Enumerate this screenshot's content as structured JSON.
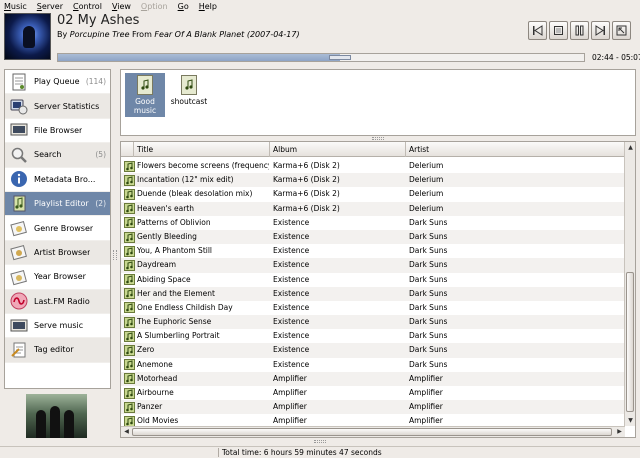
{
  "menu": [
    {
      "u": "M",
      "rest": "usic",
      "enabled": true
    },
    {
      "u": "S",
      "rest": "erver",
      "enabled": true
    },
    {
      "u": "C",
      "rest": "ontrol",
      "enabled": true
    },
    {
      "u": "V",
      "rest": "iew",
      "enabled": true
    },
    {
      "u": "O",
      "rest": "ption",
      "enabled": false
    },
    {
      "u": "G",
      "rest": "o",
      "enabled": true
    },
    {
      "u": "H",
      "rest": "elp",
      "enabled": true
    }
  ],
  "now_playing": {
    "title": "02 My Ashes",
    "by_label": "By",
    "artist": "Porcupine Tree",
    "from_label": "From",
    "album": "Fear Of A Blank Planet (2007-04-17)",
    "time": "02:44 - 05:07",
    "progress": 0.537
  },
  "controls": [
    {
      "name": "previous-track-button",
      "icon": "previous-icon"
    },
    {
      "name": "stop-button",
      "icon": "stop-icon"
    },
    {
      "name": "pause-button",
      "icon": "pause-icon"
    },
    {
      "name": "next-track-button",
      "icon": "next-icon"
    },
    {
      "name": "fullscreen-button",
      "icon": "fullscreen-icon"
    }
  ],
  "sidebar": [
    {
      "label": "Play Queue",
      "count": "(114)",
      "icon": "playlist-icon"
    },
    {
      "label": "Server Statistics",
      "count": "",
      "icon": "server-icon"
    },
    {
      "label": "File Browser",
      "count": "",
      "icon": "folder-icon"
    },
    {
      "label": "Search",
      "count": "(5)",
      "icon": "search-icon"
    },
    {
      "label": "Metadata Bro...",
      "count": "",
      "icon": "info-icon"
    },
    {
      "label": "Playlist Editor",
      "count": "(2)",
      "icon": "playlist-editor-icon",
      "selected": true
    },
    {
      "label": "Genre Browser",
      "count": "",
      "icon": "genre-icon"
    },
    {
      "label": "Artist Browser",
      "count": "",
      "icon": "artist-icon"
    },
    {
      "label": "Year Browser",
      "count": "",
      "icon": "year-icon"
    },
    {
      "label": "Last.FM Radio",
      "count": "",
      "icon": "lastfm-icon"
    },
    {
      "label": "Serve music",
      "count": "",
      "icon": "serve-icon"
    },
    {
      "label": "Tag editor",
      "count": "",
      "icon": "tag-icon"
    }
  ],
  "playlists": [
    {
      "label": "Good music",
      "selected": true
    },
    {
      "label": "shoutcast",
      "selected": false
    }
  ],
  "columns": [
    "Title",
    "Album",
    "Artist"
  ],
  "rows": [
    [
      "Flowers become screens (frequency ...",
      "Karma+6 (Disk 2)",
      "Delerium"
    ],
    [
      "Incantation (12\" mix edit)",
      "Karma+6 (Disk 2)",
      "Delerium"
    ],
    [
      "Duende (bleak desolation mix)",
      "Karma+6 (Disk 2)",
      "Delerium"
    ],
    [
      "Heaven's earth",
      "Karma+6 (Disk 2)",
      "Delerium"
    ],
    [
      "Patterns of Oblivion",
      "Existence",
      "Dark Suns"
    ],
    [
      "Gently Bleeding",
      "Existence",
      "Dark Suns"
    ],
    [
      "You, A Phantom Still",
      "Existence",
      "Dark Suns"
    ],
    [
      "Daydream",
      "Existence",
      "Dark Suns"
    ],
    [
      "Abiding Space",
      "Existence",
      "Dark Suns"
    ],
    [
      "Her and the Element",
      "Existence",
      "Dark Suns"
    ],
    [
      "One Endless Childish Day",
      "Existence",
      "Dark Suns"
    ],
    [
      "The Euphoric Sense",
      "Existence",
      "Dark Suns"
    ],
    [
      "A Slumberling Portrait",
      "Existence",
      "Dark Suns"
    ],
    [
      "Zero",
      "Existence",
      "Dark Suns"
    ],
    [
      "Anemone",
      "Existence",
      "Dark Suns"
    ],
    [
      "Motorhead",
      "Amplifier",
      "Amplifier"
    ],
    [
      "Airbourne",
      "Amplifier",
      "Amplifier"
    ],
    [
      "Panzer",
      "Amplifier",
      "Amplifier"
    ],
    [
      "Old Movies",
      "Amplifier",
      "Amplifier"
    ]
  ],
  "status": {
    "total_time": "Total time: 6 hours 59 minutes 47 seconds"
  }
}
